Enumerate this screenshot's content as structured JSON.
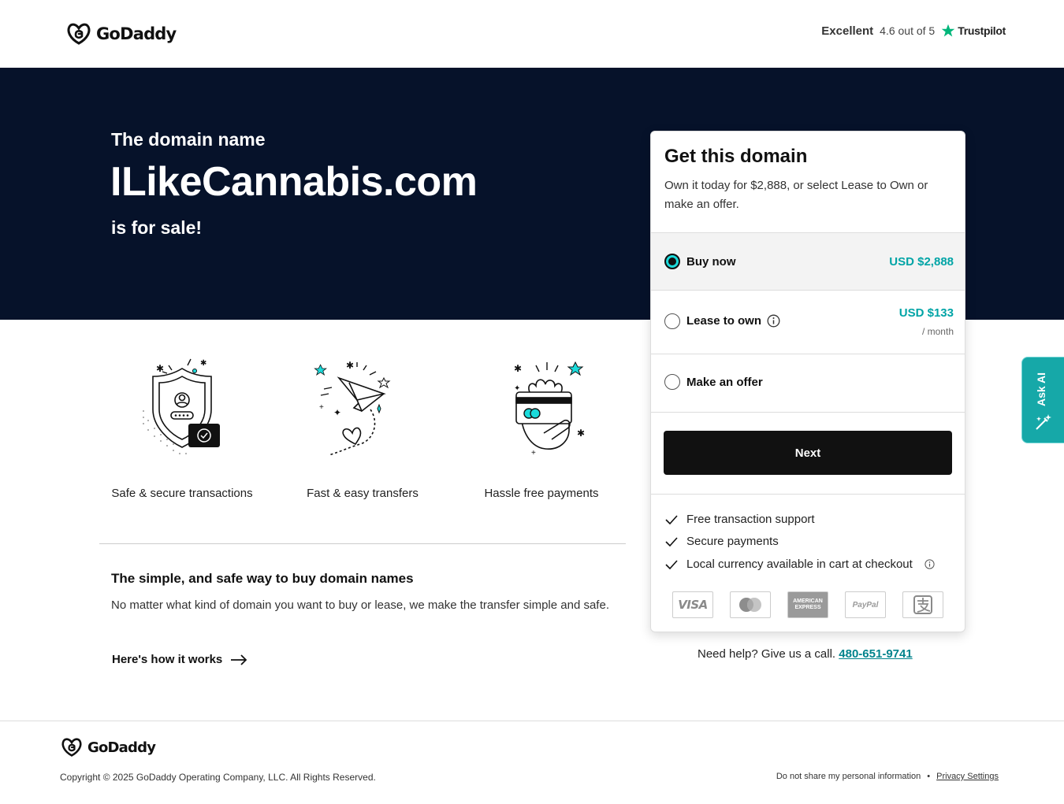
{
  "header": {
    "brand": "GoDaddy",
    "trustpilot": {
      "rating_word": "Excellent",
      "score_text": "4.6 out of 5",
      "brand": "Trustpilot"
    }
  },
  "hero": {
    "pre": "The domain name",
    "domain": "ILikeCannabis.com",
    "post": "is for sale!"
  },
  "features": [
    {
      "label": "Safe & secure transactions",
      "icon": "shield-check-icon"
    },
    {
      "label": "Fast & easy transfers",
      "icon": "paper-plane-icon"
    },
    {
      "label": "Hassle free payments",
      "icon": "hand-card-icon"
    }
  ],
  "info": {
    "title": "The simple, and safe way to buy domain names",
    "text": "No matter what kind of domain you want to buy or lease, we make the transfer simple and safe.",
    "link": "Here's how it works"
  },
  "card": {
    "title": "Get this domain",
    "subtitle": "Own it today for $2,888, or select Lease to Own or make an offer.",
    "options": [
      {
        "label": "Buy now",
        "price": "USD $2,888",
        "selected": true
      },
      {
        "label": "Lease to own",
        "price": "USD $133",
        "per": "/ month",
        "selected": false
      },
      {
        "label": "Make an offer",
        "selected": false
      }
    ],
    "next_label": "Next",
    "bullets": [
      "Free transaction support",
      "Secure payments",
      "Local currency available in cart at checkout"
    ],
    "payment_methods": [
      "VISA",
      "mastercard",
      "AMERICAN EXPRESS",
      "PayPal",
      "Alipay"
    ]
  },
  "help": {
    "text": "Need help? Give us a call.",
    "phone": "480-651-9741"
  },
  "ask_ai": "Ask AI",
  "footer": {
    "brand": "GoDaddy",
    "copyright": "Copyright © 2025 GoDaddy Operating Company, LLC. All Rights Reserved.",
    "do_not_share": "Do not share my personal information",
    "separator": "•",
    "privacy": "Privacy Settings"
  },
  "colors": {
    "hero_bg": "#06122a",
    "accent": "#00a4a6",
    "button": "#111111",
    "teal": "#1bdbdb"
  }
}
